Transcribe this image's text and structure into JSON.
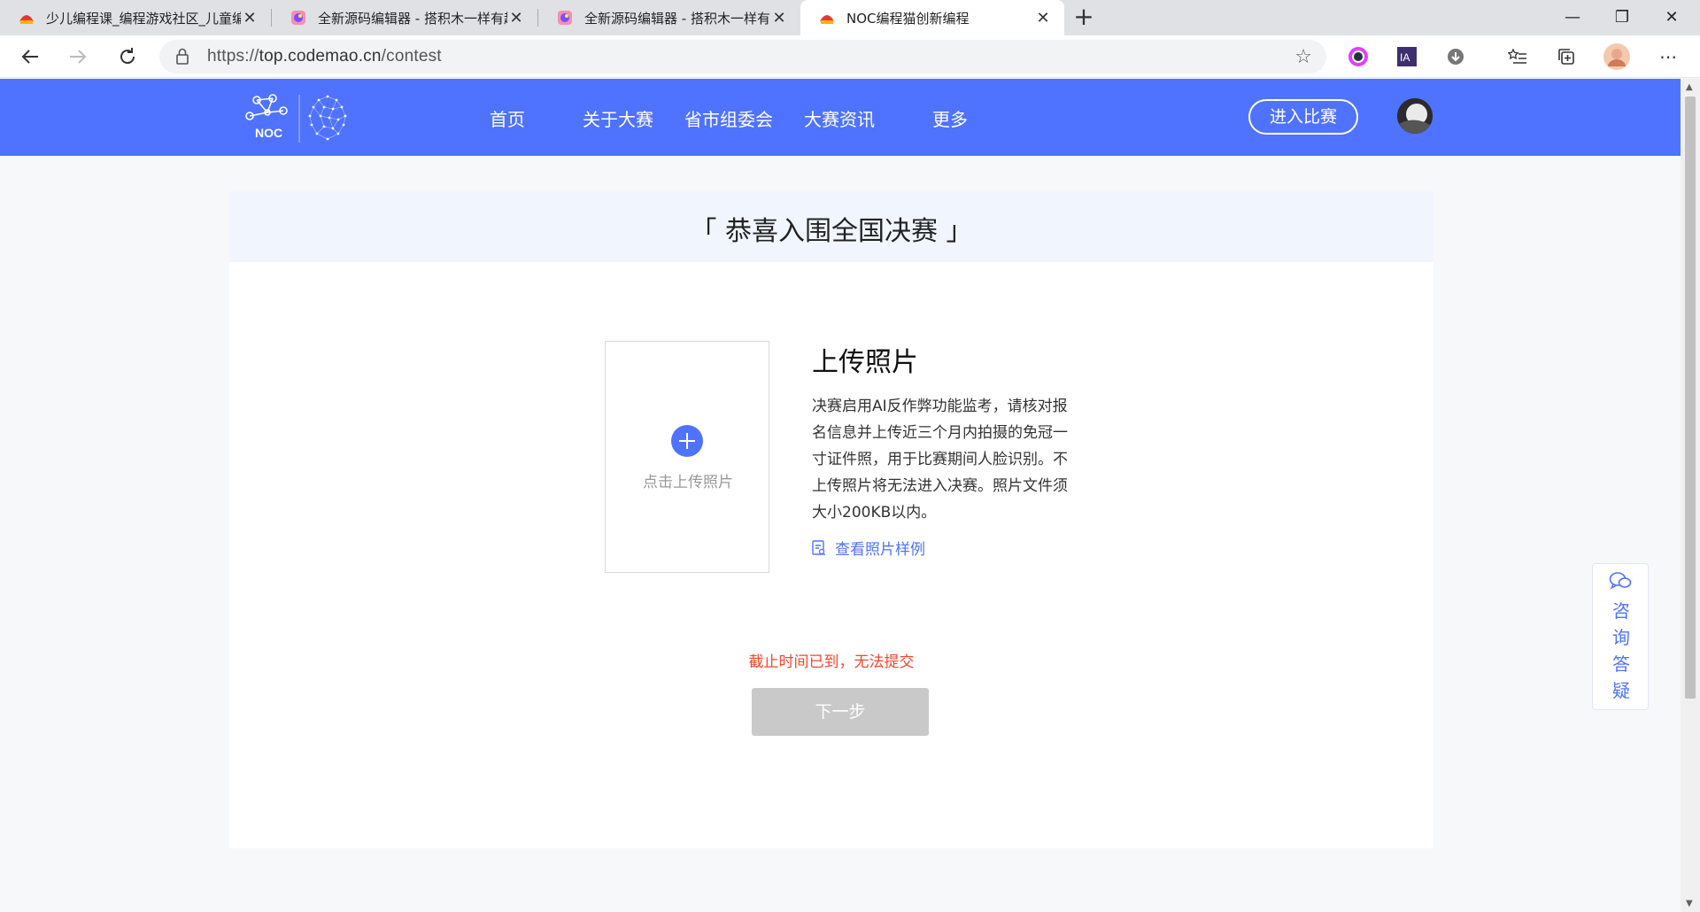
{
  "browser": {
    "tabs": [
      {
        "title": "少儿编程课_编程游戏社区_儿童编",
        "active": false
      },
      {
        "title": "全新源码编辑器 - 搭积木一样有趣",
        "active": false
      },
      {
        "title": "全新源码编辑器 - 搭积木一样有趣",
        "active": false
      },
      {
        "title": "NOC编程猫创新编程",
        "active": true
      }
    ],
    "close_glyph": "✕",
    "new_tab_glyph": "+",
    "window_controls": {
      "minimize": "—",
      "restore": "❐",
      "close": "✕"
    },
    "url_scheme": "https://",
    "url_host": "top.codemao.cn",
    "url_path": "/contest",
    "star_glyph": "☆",
    "more_glyph": "⋯"
  },
  "site": {
    "brand_color": "#4f72ff",
    "logo_text": "NOC",
    "nav": [
      {
        "label": "首页"
      },
      {
        "label": "关于大赛"
      },
      {
        "label": "省市组委会"
      },
      {
        "label": "大赛资讯"
      },
      {
        "label": "更多"
      }
    ],
    "enter_button": "进入比赛"
  },
  "main": {
    "banner_title": "「 恭喜入围全国决赛 」",
    "upload_hint": "点击上传照片",
    "upload_heading": "上传照片",
    "upload_description": "决赛启用AI反作弊功能监考，请核对报名信息并上传近三个月内拍摄的免冠一寸证件照，用于比赛期间人脸识别。不上传照片将无法进入决赛。照片文件须大小200KB以内。",
    "sample_link": "查看照片样例",
    "deadline_notice": "截止时间已到，无法提交",
    "next_button": "下一步"
  },
  "consult": {
    "chars": [
      "咨",
      "询",
      "答",
      "疑"
    ]
  }
}
